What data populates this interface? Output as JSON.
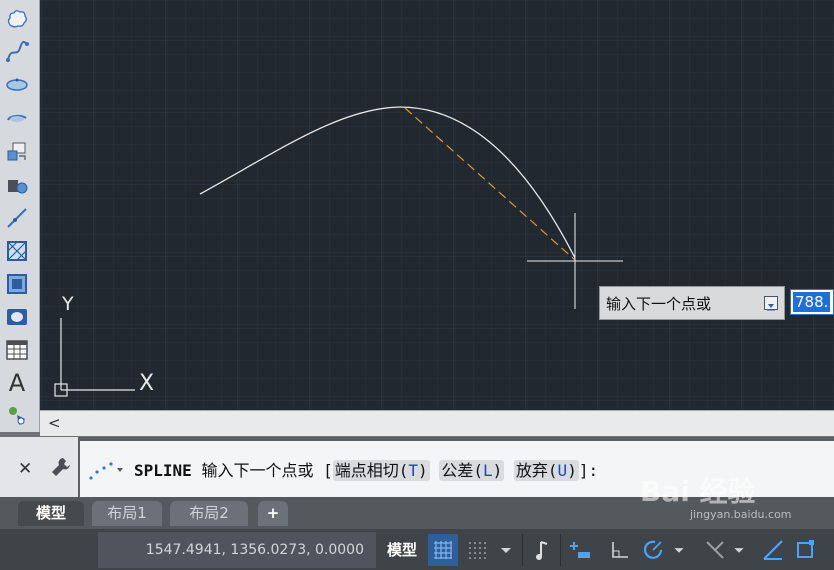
{
  "toolbar": {
    "tools": [
      "revision-cloud-icon",
      "spline-icon",
      "ellipse-icon",
      "ellipse-arc-icon",
      "insert-block-icon",
      "make-block-icon",
      "point-icon",
      "hatch-icon",
      "gradient-icon",
      "region-icon",
      "table-icon",
      "multiline-text-icon",
      "add-selected-icon"
    ],
    "text_tool_glyph": "A"
  },
  "canvas": {
    "background": "#212830",
    "ucs": {
      "y_label": "Y",
      "x_label": "X"
    }
  },
  "dynamic_input": {
    "prompt": "输入下一个点或",
    "value": "788.",
    "dropdown_icon": "dropdown-arrow-icon"
  },
  "scrollbar": {
    "left_arrow": "<"
  },
  "command_line": {
    "close_label": "✕",
    "command": "SPLINE",
    "prompt": "输入下一个点或",
    "open_bracket": "[",
    "options": [
      {
        "label": "端点相切",
        "key": "T"
      },
      {
        "label": "公差",
        "key": "L"
      },
      {
        "label": "放弃",
        "key": "U"
      }
    ],
    "close_bracket": "]:"
  },
  "layout_tabs": [
    "模型",
    "布局1",
    "布局2"
  ],
  "add_tab_label": "+",
  "status_bar": {
    "coordinates": "1547.4941, 1356.0273, 0.0000",
    "model_label": "模型"
  },
  "watermark": {
    "text": "Bai 经验",
    "sub": "jingyan.baidu.com"
  },
  "colors": {
    "accent_blue": "#1e6fd9",
    "rubber_band": "#d89a2a",
    "curve": "#e8e8e8"
  }
}
